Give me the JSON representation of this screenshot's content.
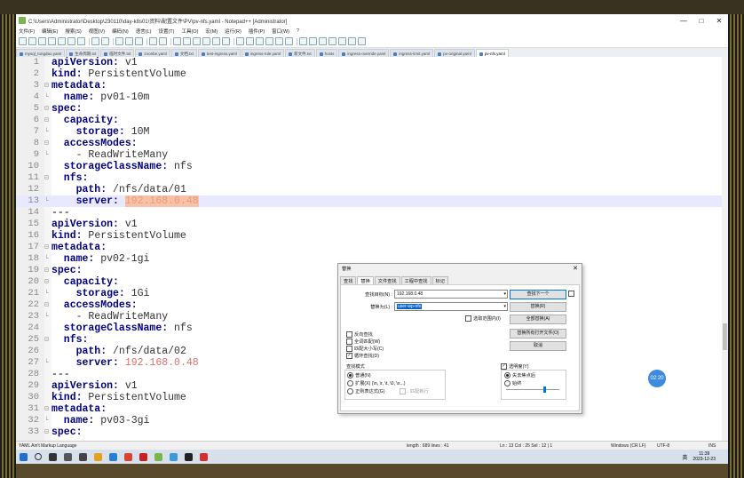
{
  "window": {
    "title": "C:\\Users\\Administrator\\Desktop\\230110\\day-k8s01\\资料\\配置文件\\PV\\pv-nfs.yaml - Notepad++ [Administrator]",
    "minimize": "—",
    "maximize": "□",
    "close": "✕"
  },
  "menu": [
    "文件(F)",
    "编辑(E)",
    "搜索(S)",
    "视图(V)",
    "编码(N)",
    "语言(L)",
    "设置(T)",
    "工具(O)",
    "宏(M)",
    "运行(R)",
    "插件(P)",
    "窗口(W)",
    "?"
  ],
  "tabs": [
    {
      "label": "mysql_tongdao.yaml",
      "active": false
    },
    {
      "label": "生命周期.txt",
      "active": false
    },
    {
      "label": "临时文件.txt",
      "active": false
    },
    {
      "label": "zoonbe.yaml",
      "active": false
    },
    {
      "label": "文档.txt",
      "active": false
    },
    {
      "label": "test-ingress.yaml",
      "active": false
    },
    {
      "label": "ingress-rule.yaml",
      "active": false
    },
    {
      "label": "新文件.txt",
      "active": false
    },
    {
      "label": "hosts",
      "active": false
    },
    {
      "label": "ingress-override.yaml",
      "active": false
    },
    {
      "label": "ingress-limit.yaml",
      "active": false
    },
    {
      "label": "pv-original.yaml",
      "active": false
    },
    {
      "label": "pv-nfs.yaml",
      "active": true
    }
  ],
  "editor": {
    "current_line": 13,
    "lines": [
      {
        "n": "1",
        "fold": "",
        "parts": [
          {
            "t": "apiVersion:",
            "c": "k"
          },
          {
            "t": " v1",
            "c": "v"
          }
        ]
      },
      {
        "n": "2",
        "fold": "",
        "parts": [
          {
            "t": "kind:",
            "c": "k"
          },
          {
            "t": " PersistentVolume",
            "c": "v"
          }
        ]
      },
      {
        "n": "3",
        "fold": "⊟",
        "parts": [
          {
            "t": "metadata:",
            "c": "k"
          }
        ]
      },
      {
        "n": "4",
        "fold": "└",
        "parts": [
          {
            "t": "  name:",
            "c": "k"
          },
          {
            "t": " pv01-10m",
            "c": "v"
          }
        ]
      },
      {
        "n": "5",
        "fold": "⊟",
        "parts": [
          {
            "t": "spec:",
            "c": "k"
          }
        ]
      },
      {
        "n": "6",
        "fold": "⊟",
        "parts": [
          {
            "t": "  capacity:",
            "c": "k"
          }
        ]
      },
      {
        "n": "7",
        "fold": "└",
        "parts": [
          {
            "t": "    storage:",
            "c": "k"
          },
          {
            "t": " 10M",
            "c": "v"
          }
        ]
      },
      {
        "n": "8",
        "fold": "⊟",
        "parts": [
          {
            "t": "  accessModes:",
            "c": "k"
          }
        ]
      },
      {
        "n": "9",
        "fold": "└",
        "parts": [
          {
            "t": "    - ReadWriteMany",
            "c": "v"
          }
        ]
      },
      {
        "n": "10",
        "fold": "",
        "parts": [
          {
            "t": "  storageClassName:",
            "c": "k"
          },
          {
            "t": " nfs",
            "c": "v"
          }
        ]
      },
      {
        "n": "11",
        "fold": "⊟",
        "parts": [
          {
            "t": "  nfs:",
            "c": "k"
          }
        ]
      },
      {
        "n": "12",
        "fold": "",
        "parts": [
          {
            "t": "    path:",
            "c": "k"
          },
          {
            "t": " /nfs/data/01",
            "c": "v"
          }
        ]
      },
      {
        "n": "13",
        "fold": "└",
        "parts": [
          {
            "t": "    server:",
            "c": "k"
          },
          {
            "t": " ",
            "c": "v"
          },
          {
            "t": "192.168.0.48",
            "c": "ip-hl"
          }
        ]
      },
      {
        "n": "14",
        "fold": "",
        "parts": [
          {
            "t": "---",
            "c": "sep"
          }
        ]
      },
      {
        "n": "15",
        "fold": "",
        "parts": [
          {
            "t": "apiVersion:",
            "c": "k"
          },
          {
            "t": " v1",
            "c": "v"
          }
        ]
      },
      {
        "n": "16",
        "fold": "",
        "parts": [
          {
            "t": "kind:",
            "c": "k"
          },
          {
            "t": " PersistentVolume",
            "c": "v"
          }
        ]
      },
      {
        "n": "17",
        "fold": "⊟",
        "parts": [
          {
            "t": "metadata:",
            "c": "k"
          }
        ]
      },
      {
        "n": "18",
        "fold": "└",
        "parts": [
          {
            "t": "  name:",
            "c": "k"
          },
          {
            "t": " pv02-1gi",
            "c": "v"
          }
        ]
      },
      {
        "n": "19",
        "fold": "⊟",
        "parts": [
          {
            "t": "spec:",
            "c": "k"
          }
        ]
      },
      {
        "n": "20",
        "fold": "⊟",
        "parts": [
          {
            "t": "  capacity:",
            "c": "k"
          }
        ]
      },
      {
        "n": "21",
        "fold": "└",
        "parts": [
          {
            "t": "    storage:",
            "c": "k"
          },
          {
            "t": " 1Gi",
            "c": "v"
          }
        ]
      },
      {
        "n": "22",
        "fold": "⊟",
        "parts": [
          {
            "t": "  accessModes:",
            "c": "k"
          }
        ]
      },
      {
        "n": "23",
        "fold": "└",
        "parts": [
          {
            "t": "    - ReadWriteMany",
            "c": "v"
          }
        ]
      },
      {
        "n": "24",
        "fold": "",
        "parts": [
          {
            "t": "  storageClassName:",
            "c": "k"
          },
          {
            "t": " nfs",
            "c": "v"
          }
        ]
      },
      {
        "n": "25",
        "fold": "⊟",
        "parts": [
          {
            "t": "  nfs:",
            "c": "k"
          }
        ]
      },
      {
        "n": "26",
        "fold": "",
        "parts": [
          {
            "t": "    path:",
            "c": "k"
          },
          {
            "t": " /nfs/data/02",
            "c": "v"
          }
        ]
      },
      {
        "n": "27",
        "fold": "└",
        "parts": [
          {
            "t": "    server:",
            "c": "k"
          },
          {
            "t": " ",
            "c": "v"
          },
          {
            "t": "192.168.0.48",
            "c": "ip"
          }
        ]
      },
      {
        "n": "28",
        "fold": "",
        "parts": [
          {
            "t": "---",
            "c": "sep"
          }
        ]
      },
      {
        "n": "29",
        "fold": "",
        "parts": [
          {
            "t": "apiVersion:",
            "c": "k"
          },
          {
            "t": " v1",
            "c": "v"
          }
        ]
      },
      {
        "n": "30",
        "fold": "",
        "parts": [
          {
            "t": "kind:",
            "c": "k"
          },
          {
            "t": " PersistentVolume",
            "c": "v"
          }
        ]
      },
      {
        "n": "31",
        "fold": "⊟",
        "parts": [
          {
            "t": "metadata:",
            "c": "k"
          }
        ]
      },
      {
        "n": "32",
        "fold": "└",
        "parts": [
          {
            "t": "  name:",
            "c": "k"
          },
          {
            "t": " pv03-3gi",
            "c": "v"
          }
        ]
      },
      {
        "n": "33",
        "fold": "⊟",
        "parts": [
          {
            "t": "spec:",
            "c": "k"
          }
        ]
      }
    ]
  },
  "dialog": {
    "title": "替换",
    "close": "✕",
    "tabs": [
      "查找",
      "替换",
      "文件查找",
      "工程中查找",
      "标记"
    ],
    "find_label": "查找目标(N) :",
    "find_value": "192.168.0.48",
    "replace_label": "替换为(L) :",
    "replace_value": "user-wp-nfs",
    "in_selection": "选取范围内(I)",
    "btn_find_next": "查找下一个",
    "btn_replace": "替换(R)",
    "btn_replace_all": "全部替换(A)",
    "btn_replace_all_open": "替换所有打开文件(O)",
    "btn_cancel": "取消",
    "opt_backward": "反向查找",
    "opt_whole_word": "全词匹配(W)",
    "opt_match_case": "匹配大小写(C)",
    "opt_wrap": "循环查找(D)",
    "search_mode_title": "查找模式",
    "mode_normal": "普通(N)",
    "mode_extended": "扩展(X) (\\n, \\r, \\t, \\0, \\x...)",
    "mode_regex": "正则表达式(G)",
    "dot_newline": ". 匹配新行",
    "transparency": "透明度(Y)",
    "trans_on_lose_focus": "失去焦点后",
    "trans_always": "始终"
  },
  "status": {
    "language": "YAML Ain't Markup Language",
    "length": "length : 689    lines : 41",
    "position": "Ln : 13    Col : 25    Sel : 12 | 1",
    "eol": "Windows (CR LF)",
    "encoding": "UTF-8",
    "mode": "INS"
  },
  "float_badge": "02:20",
  "tray": {
    "lang": "英",
    "time": "11:39",
    "date": "2023-12-23"
  },
  "colors": {
    "key": "#000080",
    "ip": "#e07070",
    "highlight": "#f7c2a8",
    "current_line": "#e8e8ff"
  }
}
